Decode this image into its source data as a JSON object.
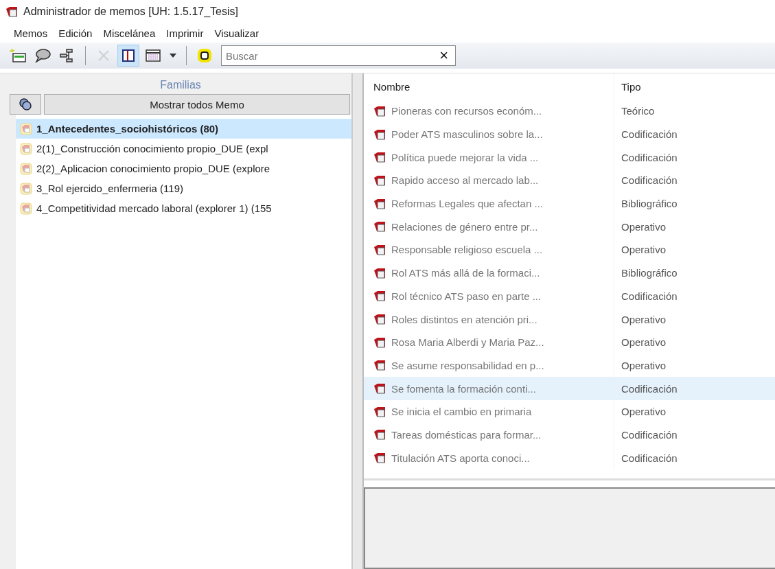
{
  "window": {
    "title": "Administrador de memos [UH: 1.5.17_Tesis]"
  },
  "menu": [
    "Memos",
    "Edición",
    "Miscelánea",
    "Imprimir",
    "Visualizar"
  ],
  "toolbar": [
    {
      "kind": "new-memo",
      "pressed": false,
      "disabled": false
    },
    {
      "kind": "comment",
      "pressed": false,
      "disabled": false
    },
    {
      "kind": "tree",
      "pressed": false,
      "disabled": false
    },
    {
      "kind": "separator"
    },
    {
      "kind": "delete",
      "pressed": false,
      "disabled": true
    },
    {
      "kind": "panel",
      "pressed": true,
      "disabled": false
    },
    {
      "kind": "grid",
      "pressed": false,
      "disabled": false
    },
    {
      "kind": "dropdown",
      "pressed": false,
      "disabled": false
    },
    {
      "kind": "separator"
    },
    {
      "kind": "filter",
      "pressed": false,
      "disabled": false
    }
  ],
  "search": {
    "placeholder": "Buscar",
    "clear": "×"
  },
  "families": {
    "title": "Familias",
    "show_all": "Mostrar todos Memo",
    "items": [
      {
        "label": "1_Antecedentes_sociohistóricos (80)",
        "selected": true
      },
      {
        "label": "2(1)_Construcción conocimiento propio_DUE (expl",
        "selected": false
      },
      {
        "label": "2(2)_Aplicacion conocimiento propio_DUE (explore",
        "selected": false
      },
      {
        "label": "3_Rol ejercido_enfermeria (119)",
        "selected": false
      },
      {
        "label": "4_Competitividad mercado laboral (explorer 1) (155",
        "selected": false
      }
    ]
  },
  "memos": {
    "columns": [
      "Nombre",
      "Tipo"
    ],
    "rows": [
      {
        "name": "Pioneras con recursos económ...",
        "type": "Teórico",
        "selected": false
      },
      {
        "name": "Poder ATS masculinos sobre la...",
        "type": "Codificación",
        "selected": false
      },
      {
        "name": "Política puede mejorar la vida ...",
        "type": "Codificación",
        "selected": false
      },
      {
        "name": "Rapido acceso al mercado lab...",
        "type": "Codificación",
        "selected": false
      },
      {
        "name": "Reformas Legales que afectan ...",
        "type": "Bibliográfico",
        "selected": false
      },
      {
        "name": "Relaciones de género entre pr...",
        "type": "Operativo",
        "selected": false
      },
      {
        "name": "Responsable religioso escuela ...",
        "type": "Operativo",
        "selected": false
      },
      {
        "name": "Rol ATS más allá de la formaci...",
        "type": "Bibliográfico",
        "selected": false
      },
      {
        "name": "Rol técnico ATS paso en parte ...",
        "type": "Codificación",
        "selected": false
      },
      {
        "name": "Roles distintos en atención pri...",
        "type": "Operativo",
        "selected": false
      },
      {
        "name": "Rosa Maria Alberdi y Maria Paz...",
        "type": "Operativo",
        "selected": false
      },
      {
        "name": "Se asume responsabilidad en p...",
        "type": "Operativo",
        "selected": false
      },
      {
        "name": "Se fomenta la formación conti...",
        "type": "Codificación",
        "selected": true
      },
      {
        "name": "Se inicia el cambio en primaria",
        "type": "Operativo",
        "selected": false
      },
      {
        "name": "Tareas domésticas para formar...",
        "type": "Codificación",
        "selected": false
      },
      {
        "name": "Titulación ATS aporta conoci...",
        "type": "Codificación",
        "selected": false
      }
    ]
  }
}
